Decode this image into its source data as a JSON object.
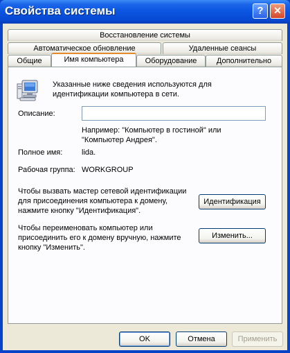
{
  "window": {
    "title": "Свойства системы"
  },
  "tabs": {
    "row1": [
      "Восстановление системы"
    ],
    "row2": [
      "Автоматическое обновление",
      "Удаленные сеансы"
    ],
    "row3": [
      "Общие",
      "Имя компьютера",
      "Оборудование",
      "Дополнительно"
    ],
    "active": "Имя компьютера"
  },
  "panel": {
    "intro": [
      "Указанные ниже сведения используются для",
      "идентификации компьютера в сети."
    ],
    "description_label": "Описание:",
    "description_value": "",
    "example": [
      "Например: \"Компьютер в гостиной\" или",
      "\"Компьютер Андрея\"."
    ],
    "fullname_label": "Полное имя:",
    "fullname_value": "lida.",
    "workgroup_label": "Рабочая группа:",
    "workgroup_value": "WORKGROUP",
    "wizard_text": [
      "Чтобы вызвать мастер сетевой идентификации",
      "для присоединения компьютера к домену,",
      "нажмите кнопку \"Идентификация\"."
    ],
    "identify_button": "Идентификация",
    "rename_text": [
      "Чтобы переименовать компьютер или",
      "присоединить его к домену вручную, нажмите",
      "кнопку \"Изменить\"."
    ],
    "change_button": "Изменить..."
  },
  "footer": {
    "ok": "OK",
    "cancel": "Отмена",
    "apply": "Применить"
  },
  "colors": {
    "titlebar": "#0a55e0",
    "face": "#ece9d8",
    "active_tab_accent": "#e68b2c"
  }
}
